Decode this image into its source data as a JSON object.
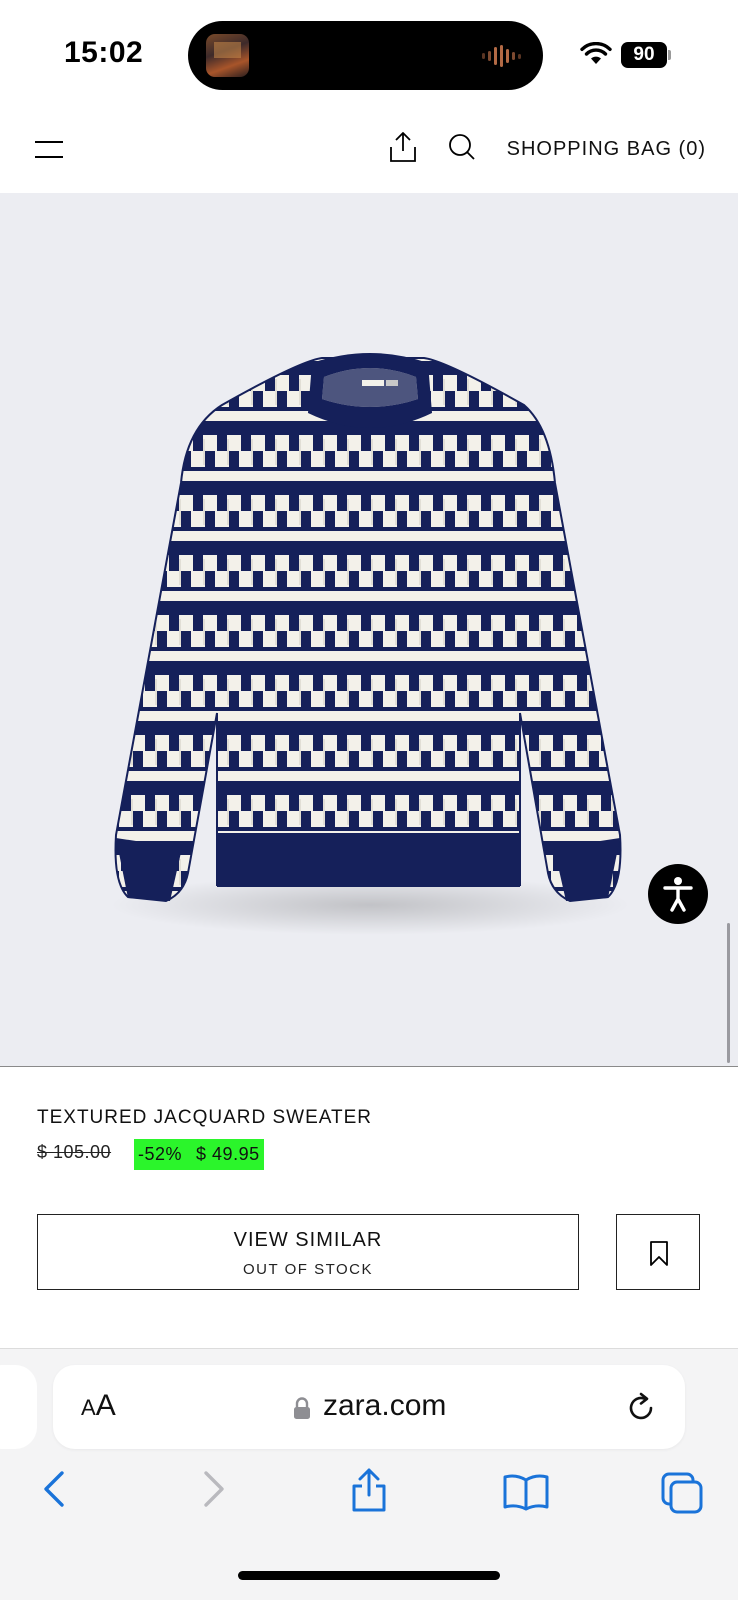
{
  "status_bar": {
    "time": "15:02",
    "battery": "90",
    "icons": [
      "now-playing-artwork",
      "audio-waveform-icon",
      "wifi-icon",
      "battery-icon"
    ]
  },
  "header": {
    "shopping_bag_label": "SHOPPING BAG (0)",
    "icons": [
      "menu-icon",
      "share-icon",
      "search-icon"
    ]
  },
  "product": {
    "name": "TEXTURED JACQUARD SWEATER",
    "original_price": "$ 105.00",
    "discount": "-52%",
    "sale_price": "$ 49.95",
    "sale_highlight_color": "#2bf52b",
    "image_alt": "navy and white textured jacquard sweater",
    "sweater_colors": {
      "navy": "#15205a",
      "cream": "#f3f1ea"
    }
  },
  "actions": {
    "view_similar_label": "VIEW SIMILAR",
    "out_of_stock_label": "OUT OF STOCK"
  },
  "browser": {
    "text_size_label": "AA",
    "url": "zara.com",
    "accent_color": "#1a73d9",
    "toolbar_icons": [
      "back-icon",
      "forward-icon",
      "share-icon",
      "bookmarks-icon",
      "tabs-icon"
    ]
  }
}
